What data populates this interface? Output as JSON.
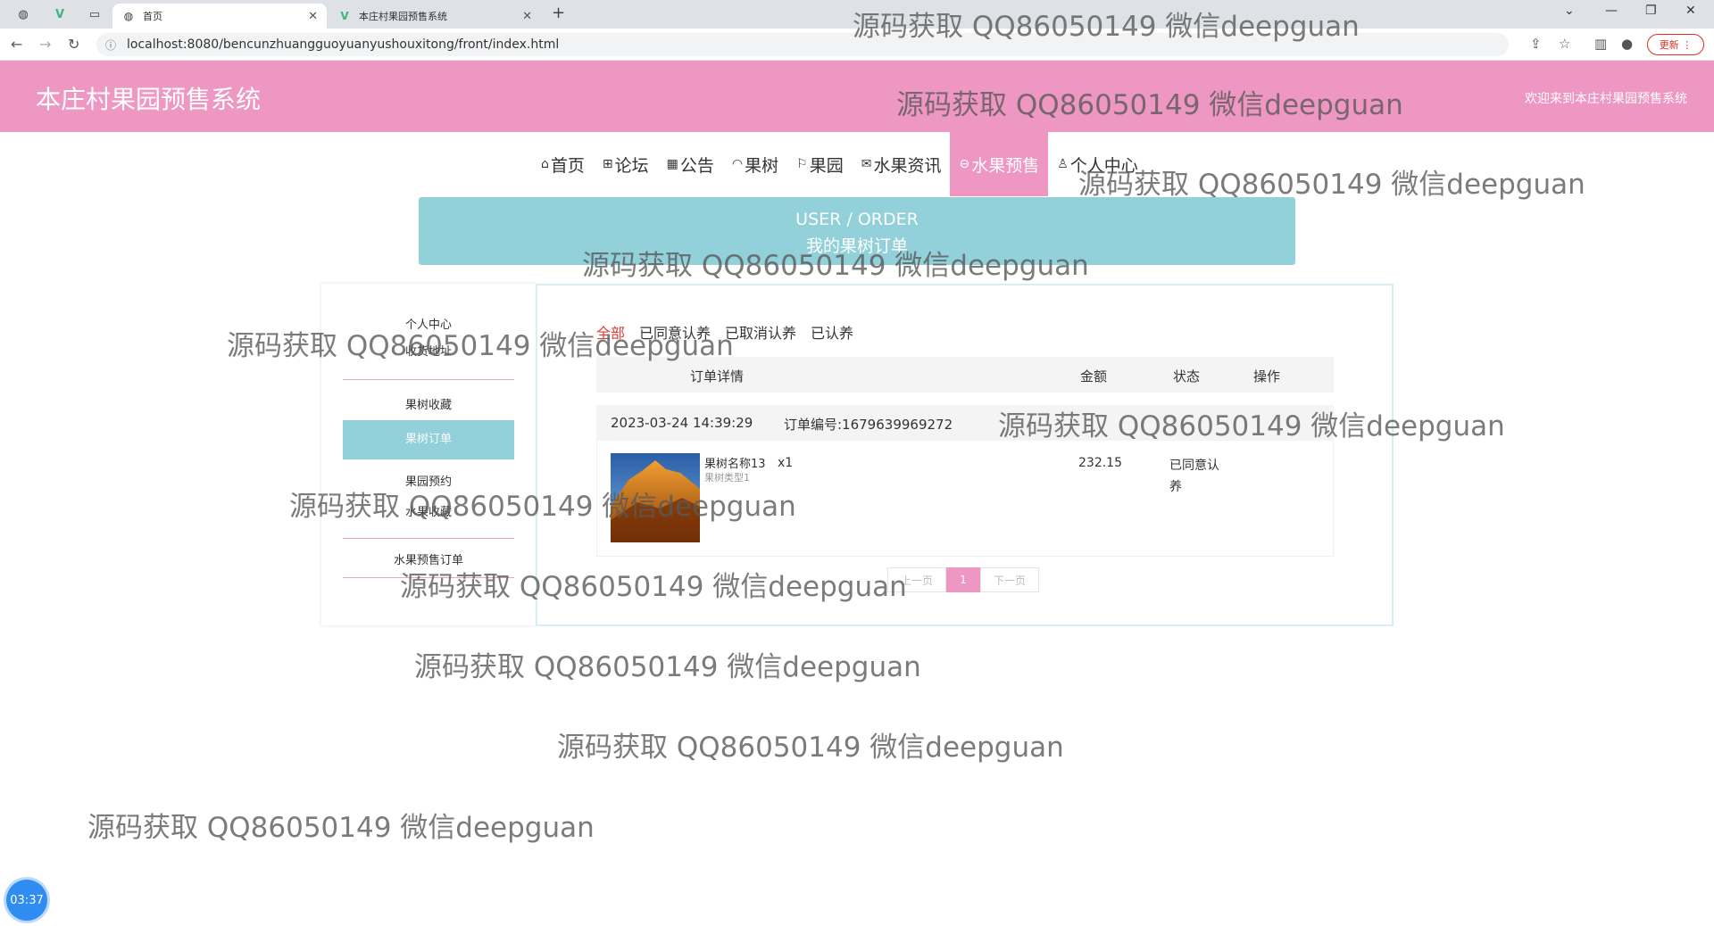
{
  "browser": {
    "tabs": [
      {
        "label": "首页",
        "icon": "globe-icon"
      },
      {
        "label": "本庄村果园预售系统",
        "icon": "vue-icon"
      }
    ],
    "url": "localhost:8080/bencunzhuangguoyuanyushouxitong/front/index.html",
    "update_label": "更新"
  },
  "header": {
    "title": "本庄村果园预售系统",
    "welcome": "欢迎来到本庄村果园预售系统"
  },
  "nav": [
    {
      "label": "首页",
      "icon": "home-icon"
    },
    {
      "label": "论坛",
      "icon": "forum-icon"
    },
    {
      "label": "公告",
      "icon": "notice-icon"
    },
    {
      "label": "果树",
      "icon": "tree-icon"
    },
    {
      "label": "果园",
      "icon": "flag-icon"
    },
    {
      "label": "水果资讯",
      "icon": "mail-icon"
    },
    {
      "label": "水果预售",
      "icon": "presale-icon"
    },
    {
      "label": "个人中心",
      "icon": "user-icon"
    }
  ],
  "banner": {
    "en": "USER / ORDER",
    "cn": "我的果树订单"
  },
  "sidebar": [
    "个人中心",
    "收货地址",
    "果树收藏",
    "果树订单",
    "果园预约",
    "水果收藏",
    "水果预售订单"
  ],
  "filters": [
    "全部",
    "已同意认养",
    "已取消认养",
    "已认养"
  ],
  "table": {
    "headers": {
      "detail": "订单详情",
      "amount": "金额",
      "status": "状态",
      "action": "操作"
    },
    "order": {
      "time": "2023-03-24 14:39:29",
      "number": "订单编号:1679639969272",
      "name": "果树名称13",
      "type": "果树类型1",
      "qty": "x1",
      "amount": "232.15",
      "status_line1": "已同意认",
      "status_line2": "养"
    }
  },
  "pager": {
    "prev": "上一页",
    "page": "1",
    "next": "下一页"
  },
  "watermark": "源码获取 QQ86050149 微信deepguan",
  "timer": "03:37"
}
